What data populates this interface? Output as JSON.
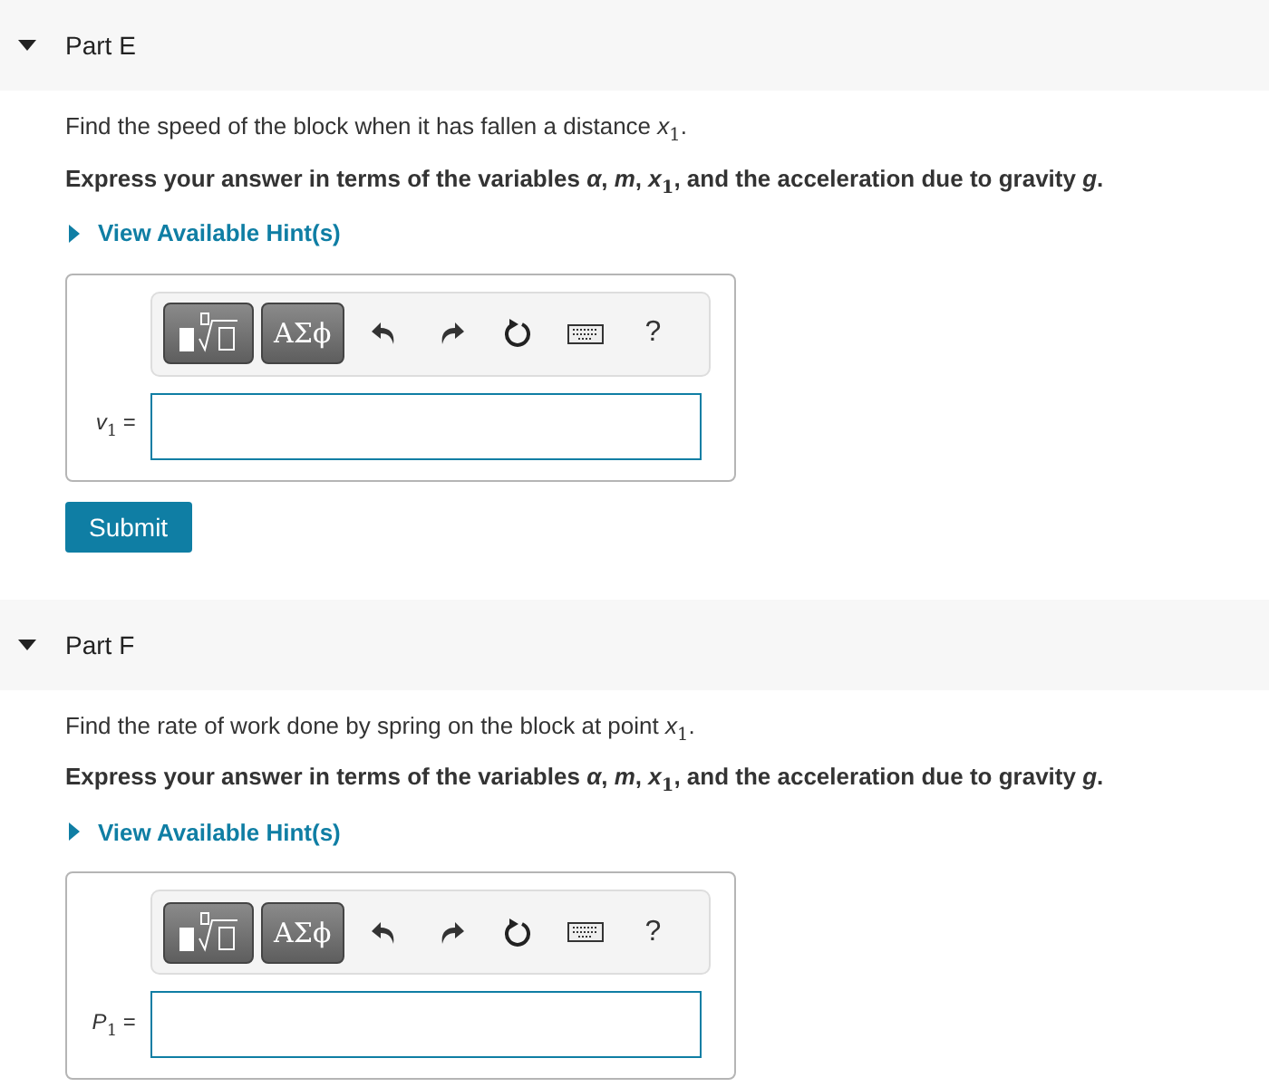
{
  "parts": [
    {
      "title": "Part E",
      "expanded": true,
      "prompt": "Find the speed of the block when it has fallen a distance *x*$_{1}$.",
      "instruction": "Express your answer in terms of the variables *α*, *m*, *x*$_{1}$, and the acceleration due to gravity *g*.",
      "hint": {
        "label": "View Available Hint(s)",
        "expanded": false
      },
      "toolbar": {
        "symbols_button": "ΑΣϕ",
        "help_button": "?"
      },
      "answer_label": "*v*$_{1}$ =",
      "submit": "Submit"
    },
    {
      "title": "Part F",
      "expanded": true,
      "prompt": "Find the rate of work done by spring on the block at point *x*$_{1}$.",
      "instruction": "Express your answer in terms of the variables *α*, *m*, *x*$_{1}$, and the acceleration due to gravity *g*.",
      "hint": {
        "label": "View Available Hint(s)",
        "expanded": false
      },
      "toolbar": {
        "symbols_button": "ΑΣϕ",
        "help_button": "?"
      },
      "answer_label": "*P*$_{1}$ ="
    }
  ]
}
